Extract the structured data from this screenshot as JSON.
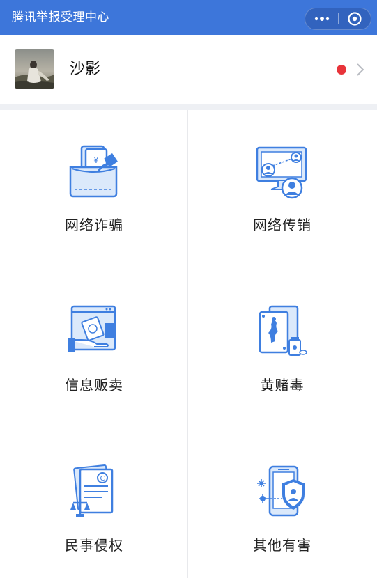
{
  "app": {
    "title": "腾讯举报受理中心",
    "more_icon": "more-dots-icon",
    "close_icon": "close-circle-icon"
  },
  "user": {
    "name": "沙影",
    "avatar_icon": "avatar-photo",
    "notification_color": "#e8343a",
    "chevron_icon": "chevron-right-icon"
  },
  "categories": [
    {
      "label": "网络诈骗",
      "icon": "wallet-card-icon"
    },
    {
      "label": "网络传销",
      "icon": "network-people-icon"
    },
    {
      "label": "信息贩卖",
      "icon": "money-hand-icon"
    },
    {
      "label": "黄赌毒",
      "icon": "cards-drugs-icon"
    },
    {
      "label": "民事侵权",
      "icon": "copyright-document-icon"
    },
    {
      "label": "其他有害",
      "icon": "phone-shield-icon"
    }
  ],
  "colors": {
    "header": "#3d76da",
    "icon_primary": "#3f7fe0",
    "icon_light": "#dbe9fb"
  }
}
